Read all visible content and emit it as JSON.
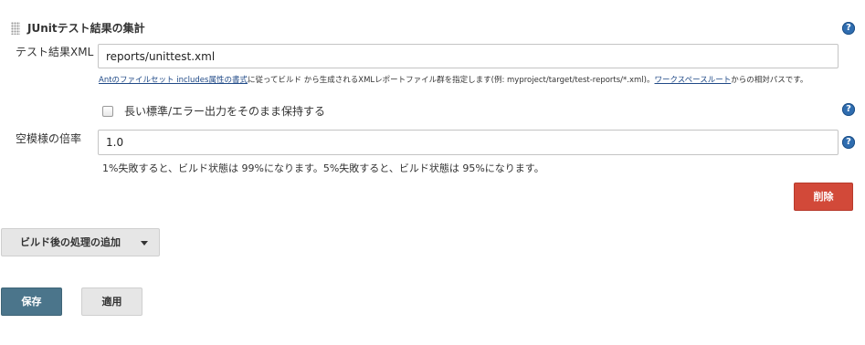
{
  "section": {
    "title": "JUnitテスト結果の集計"
  },
  "xml_field": {
    "label": "テスト結果XML",
    "value": "reports/unittest.xml",
    "description": {
      "link1": "Antのファイルセット includes属性の書式",
      "text1": "に従ってビルド から生成されるXMLレポートファイル群を指定します(例: myproject/target/test-reports/*.xml)。",
      "link2": "ワークスペースルート",
      "text2": "からの相対パスです。"
    }
  },
  "checkbox": {
    "label": "長い標準/エラー出力をそのまま保持する",
    "checked": false
  },
  "scale_field": {
    "label": "空模様の倍率",
    "value": "1.0",
    "hint": "1%失敗すると、ビルド状態は 99%になります。5%失敗すると、ビルド状態は 95%になります。"
  },
  "buttons": {
    "delete": "削除",
    "add_post_build": "ビルド後の処理の追加",
    "save": "保存",
    "apply": "適用"
  },
  "help_icon_glyph": "?",
  "colors": {
    "help_icon": "#2f6db0",
    "delete_button": "#d24939",
    "save_button": "#4b758b",
    "link": "#204a87"
  }
}
